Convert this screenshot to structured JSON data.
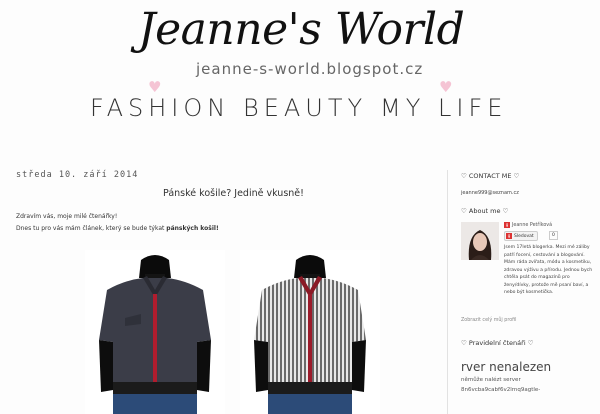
{
  "header": {
    "logo": "Jeanne's World",
    "url": "jeanne-s-world.blogspot.cz",
    "nav": [
      "FASHION",
      "BEAUTY",
      "MY LIFE"
    ]
  },
  "post": {
    "date": "středa 10. září 2014",
    "title": "Pánské košile? Jedině vkusně!",
    "greeting": "Zdravím vás, moje milé čtenářky!",
    "intro_prefix": "Dnes tu pro vás mám článek, který se bude týkat ",
    "intro_bold": "pánských košil!"
  },
  "sidebar": {
    "contact_heading": "♡ CONTACT ME ♡",
    "email": "jeanne999@seznam.cz",
    "about_heading": "♡ About me ♡",
    "profile_name": "Jeanne Petříková",
    "follow_label": "Sledovat",
    "follow_count": "0",
    "bio": "Jsem 17letá blogerka. Mezi mé záliby patří focení, cestování a blogování. Mám ráda zvířata, módu a kosmetiku, zdravou výživu a přírodu. Jednou bych chtěla psát do magazínů pro ženy/dívky, protože mě psaní baví, a nebo být kosmetička.",
    "profile_link": "Zobrazit celý můj profil",
    "rules_heading": "♡ Pravidelní čtenáři ♡",
    "error_title": "rver nenalezen",
    "error_sub_1": "němůže nalézt server",
    "error_sub_2": "8n6vcba9cabf6v2lrnq9agtle-"
  }
}
